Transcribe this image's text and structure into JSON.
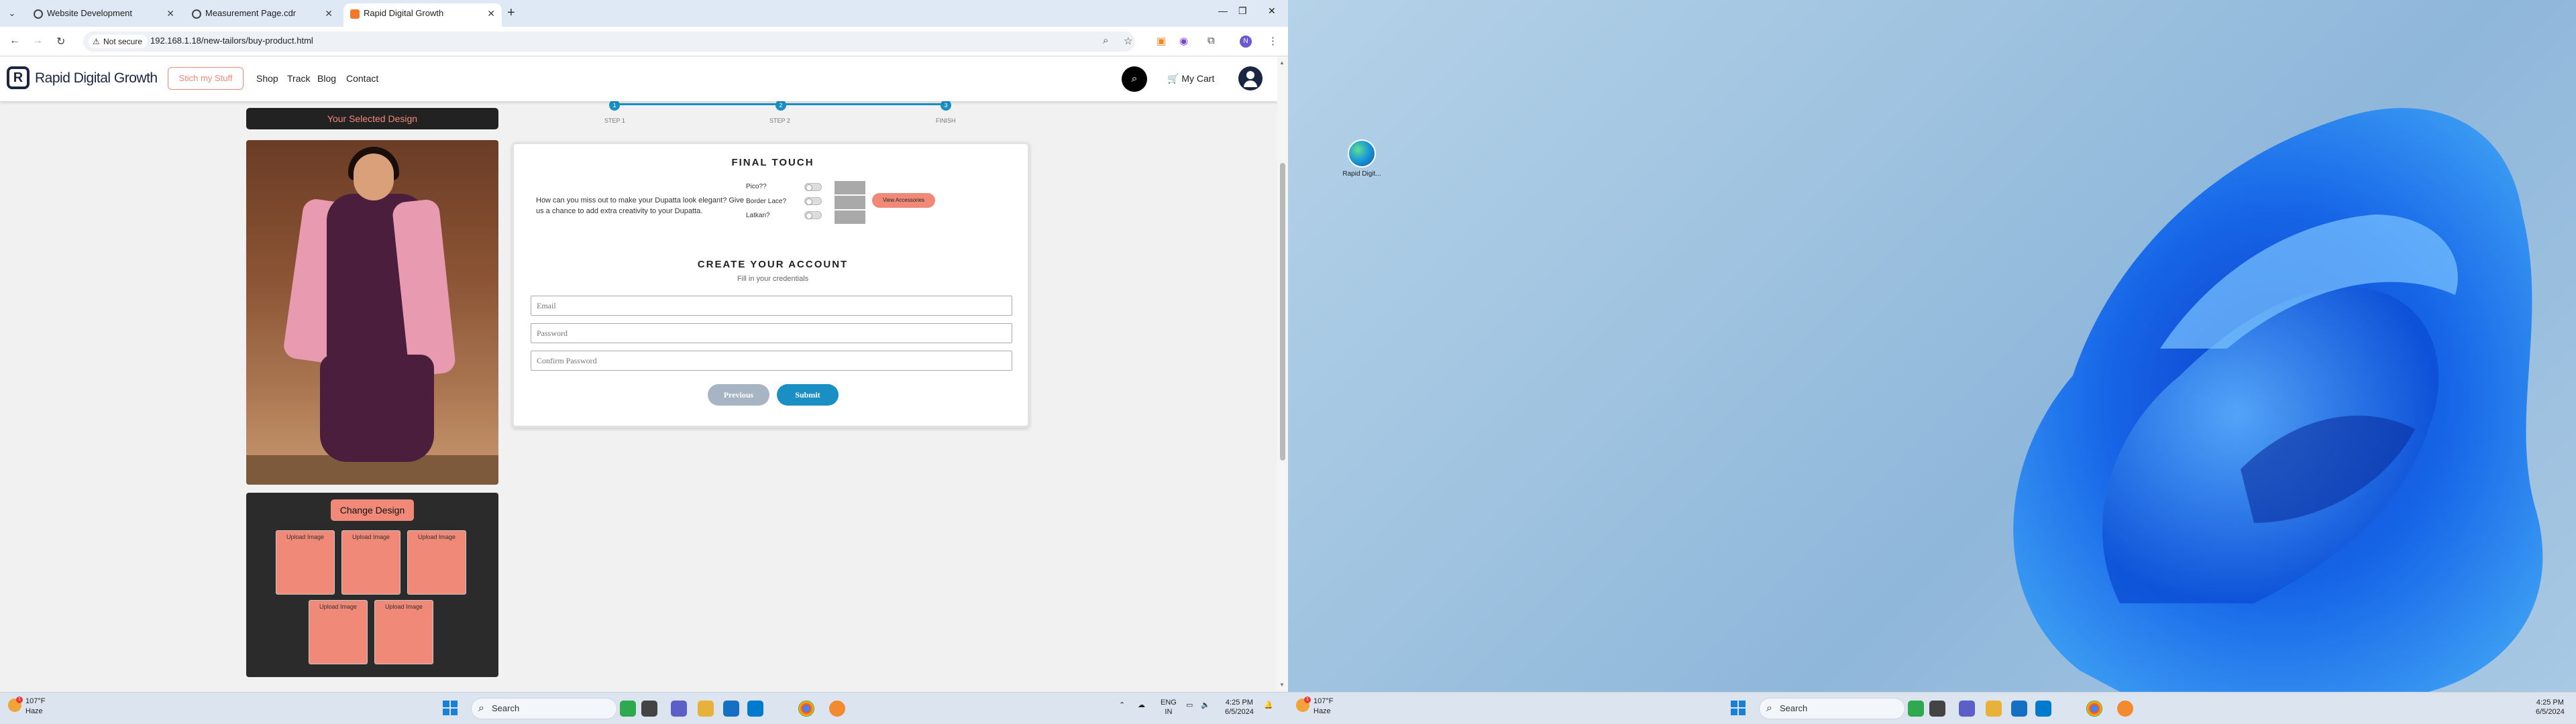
{
  "browser": {
    "tabs": [
      {
        "title": "Website Development",
        "active": false
      },
      {
        "title": "Measurement Page.cdr",
        "active": false
      },
      {
        "title": "Rapid Digital Growth",
        "active": true
      }
    ],
    "security": "Not secure",
    "url": "192.168.1.18/new-tailors/buy-product.html"
  },
  "site": {
    "logo_mark": "R",
    "logo_text": "Rapid Digital Growth",
    "stitch_button": "Stich my Stuff",
    "nav": [
      "Shop",
      "Track",
      "Blog",
      "Contact"
    ],
    "cart": "My Cart"
  },
  "steps": [
    "STEP 1",
    "STEP 2",
    "FINISH"
  ],
  "left_panel": {
    "selected_design": "Your Selected Design",
    "change_design": "Change Design",
    "upload_label": "Upload Image"
  },
  "final_touch": {
    "title": "FINAL TOUCH",
    "description": "How can you miss out to make your Dupatta look elegant? Give us a chance to add extra creativity to your Dupatta.",
    "options": [
      "Pico??",
      "Border Lace?",
      "Latkan?"
    ],
    "view_accessories": "View Accessories"
  },
  "account": {
    "title": "CREATE YOUR ACCOUNT",
    "subtitle": "Fill in your credentials",
    "email_placeholder": "Email",
    "password_placeholder": "Password",
    "confirm_placeholder": "Confirm Password",
    "previous": "Previous",
    "submit": "Submit"
  },
  "taskbar": {
    "weather_temp": "107°F",
    "weather_desc": "Haze",
    "weather_badge": "1",
    "search": "Search",
    "lang_top": "ENG",
    "lang_bottom": "IN",
    "time": "4:25 PM",
    "date": "6/5/2024"
  },
  "desktop": {
    "icon_label": "Rapid Digit..."
  },
  "colors": {
    "accent_salmon": "#f08977",
    "accent_blue": "#1a8fc4",
    "brand_navy": "#1a2544"
  }
}
